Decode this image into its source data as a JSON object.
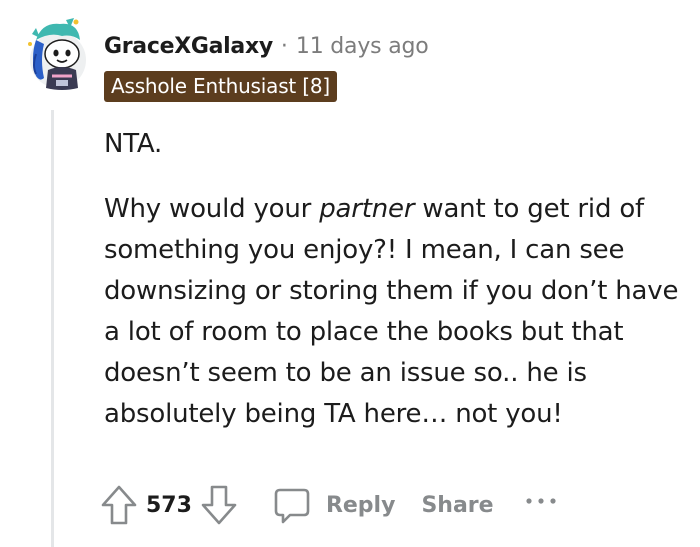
{
  "comment": {
    "username": "GraceXGalaxy",
    "separator": "·",
    "timestamp": "11 days ago",
    "flair": "Asshole Enthusiast [8]",
    "flair_color": "#5c3d1e",
    "body": {
      "para1": "NTA.",
      "para2_before": "Why would your ",
      "para2_emphasis": "partner",
      "para2_after": " want to get rid of something you enjoy?! I mean, I can see downsizing or storing them if you don’t have a lot of room to place the books but that doesn’t seem to be an issue so.. he is absolutely being TA here… not you!"
    },
    "actions": {
      "upvote_icon": "arrow-up-icon",
      "vote_count": "573",
      "downvote_icon": "arrow-down-icon",
      "reply_icon": "speech-bubble-icon",
      "reply_label": "Reply",
      "share_label": "Share",
      "more_icon": "ellipsis-icon"
    },
    "avatar_icon": "snoo-avatar-icon"
  }
}
